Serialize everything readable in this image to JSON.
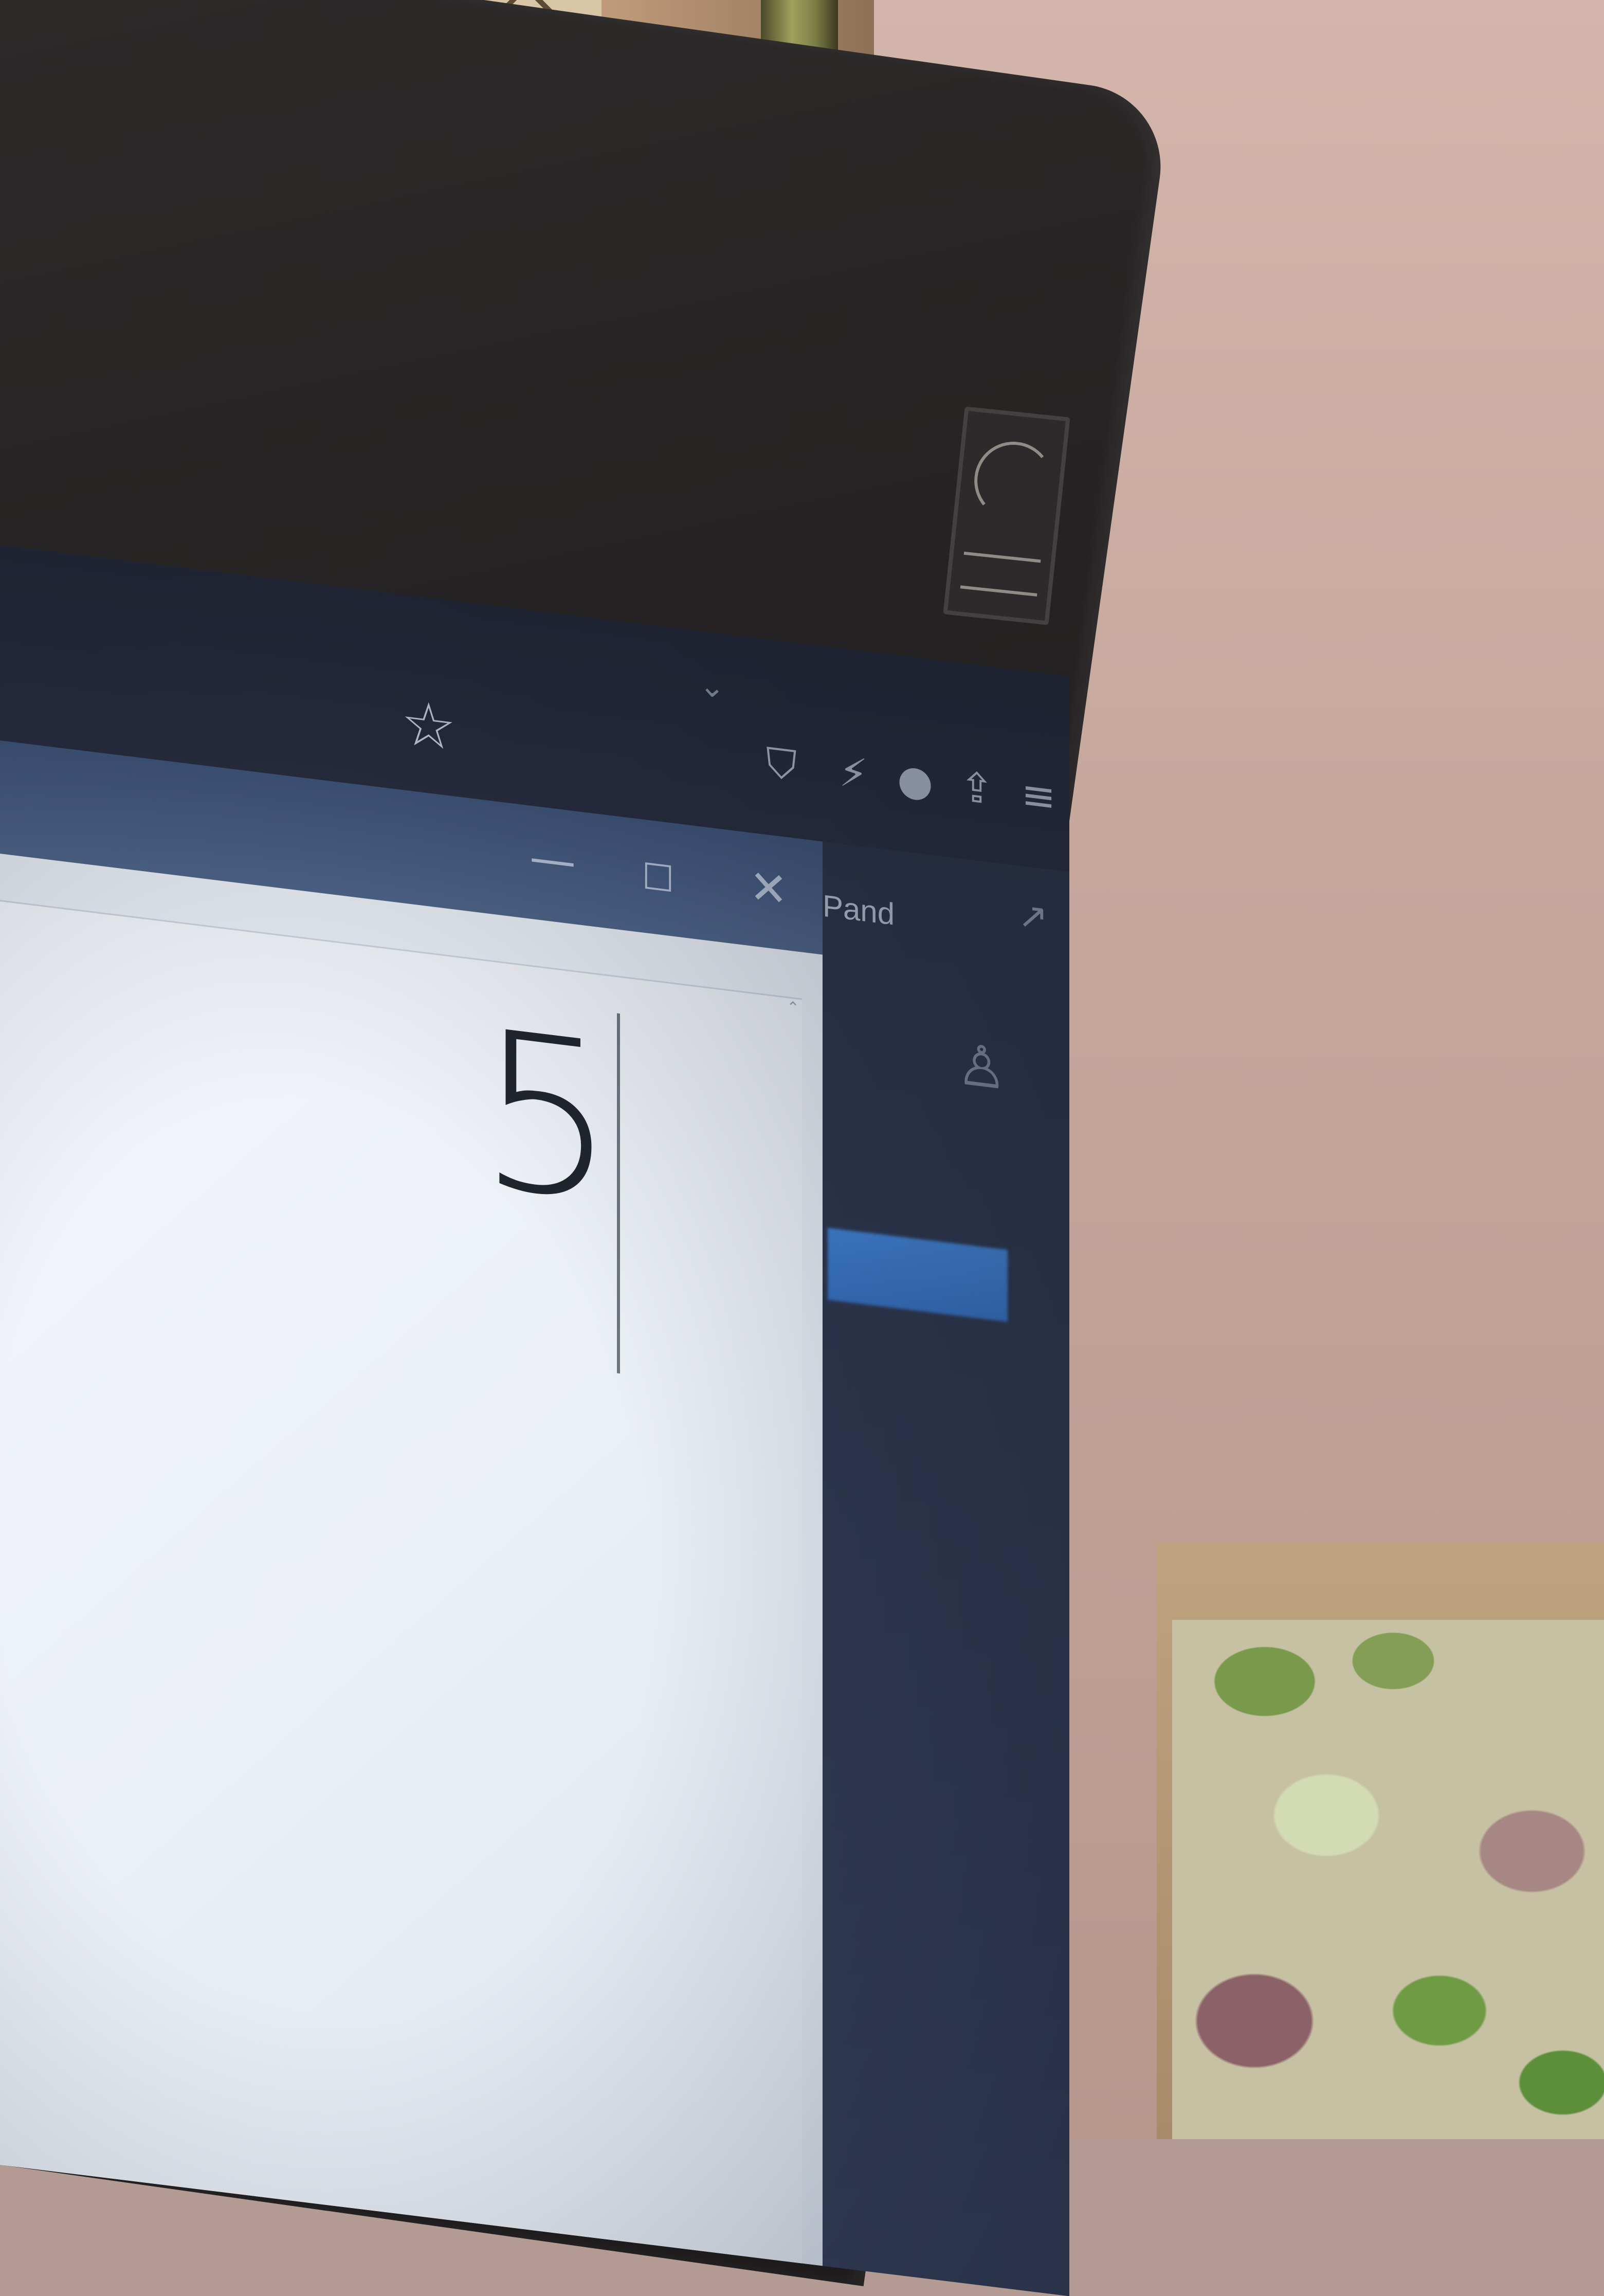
{
  "scene": {
    "description_free": true
  },
  "browser_toolbar": {
    "chevron_icon": "chevron-down-icon",
    "favorite_icon": "star-icon",
    "tool_icons": [
      "shield-icon",
      "lightning-icon",
      "gear-icon",
      "share-icon",
      "menu-icon"
    ]
  },
  "window_controls": {
    "minimize_glyph": "—",
    "maximize_glyph": "☐",
    "close_glyph": "✕"
  },
  "side_panel": {
    "title": "Pand"
  },
  "document": {
    "text": "5"
  },
  "colors": {
    "titlebar": "#4d6387",
    "panel_button": "#3f7fd0",
    "document_text": "#20242c"
  }
}
